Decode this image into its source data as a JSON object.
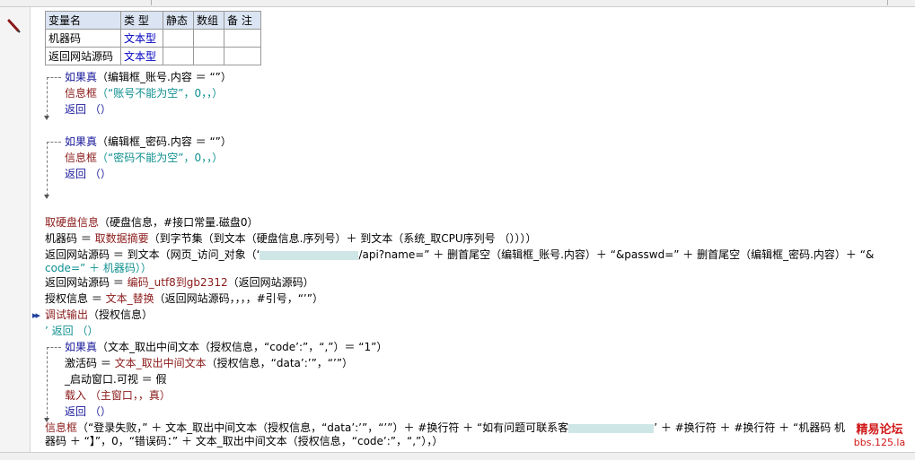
{
  "editor": {
    "var_table": {
      "headers": [
        "变量名",
        "类 型",
        "静态",
        "数组",
        "备 注"
      ],
      "rows": [
        {
          "name": "机器码",
          "type": "文本型"
        },
        {
          "name": "返回网站源码",
          "type": "文本型"
        }
      ]
    },
    "lines": {
      "if1_a": "如果真",
      "if1_b": "（编辑框_账号.内容 ＝ “”）",
      "msg1_a": "信息框",
      "msg1_b": "（“账号不能为空”，0，，）",
      "ret1": "返回 （）",
      "if2_a": "如果真",
      "if2_b": "（编辑框_密码.内容 ＝ “”）",
      "msg2_a": "信息框",
      "msg2_b": "（“密码不能为空”，0，，）",
      "ret2": "返回 （）",
      "hd_a": "取硬盘信息",
      "hd_b": "（硬盘信息，#接口常量.磁盘0）",
      "mc_a": "机器码 ＝ ",
      "mc_b": "取数据摘要",
      "mc_c": "（到字节集（到文本（硬盘信息.序列号）＋ 到文本（系统_取CPU序列号 （））））",
      "src_a": "返回网站源码 ＝ 到文本（网页_访问_对象（‘",
      "src_b": "/api?name=” ＋ 删首尾空（编辑框_账号.内容）＋ “&passwd=” ＋ 删首尾空（编辑框_密码.内容）＋ “&",
      "src_c": "code=” ＋ 机器码））",
      "enc_a": "返回网站源码 ＝ ",
      "enc_b": "编码_utf8到gb2312",
      "enc_c": "（返回网站源码）",
      "auth_a": "授权信息 ＝ ",
      "auth_b": "文本_替换",
      "auth_c": "（返回网站源码，，，，#引号，“’”）",
      "dbg_a": "调试输出",
      "dbg_b": "（授权信息）",
      "cmt": "’ 返回 （）",
      "if3_a": "如果真",
      "if3_b": "（文本_取出中间文本（授权信息，“code’:”，“,”）＝ “1”）",
      "act_a": "激活码 ＝ ",
      "act_b": "文本_取出中间文本",
      "act_c": "（授权信息，“data’:’”，“’”）",
      "vis": "_启动窗口.可视 ＝ 假",
      "load": "载入 （主窗口，，真）",
      "ret3": "返回 （）",
      "fail_a": "信息框",
      "fail_b": "（“登录失败，” ＋ 文本_取出中间文本（授权信息，“data’:’”，“’”）＋ #换行符 ＋ “如有问题可联系客",
      "fail_c": "’ ＋ #换行符 ＋ #换行符 ＋ “机器码 机",
      "fail_d": "器码 ＋ “】”，0，“错误码：” ＋ 文本_取出中间文本（授权信息，“code’:”，“,”），）"
    }
  },
  "watermark": {
    "line1": "精易论坛",
    "line2": "bbs.125.la"
  },
  "colors": {
    "keyword": "#1a1a9c",
    "function": "#8b1a1a",
    "string": "#0f8f8f",
    "type": "#0000c0",
    "watermark": "#d01818"
  }
}
